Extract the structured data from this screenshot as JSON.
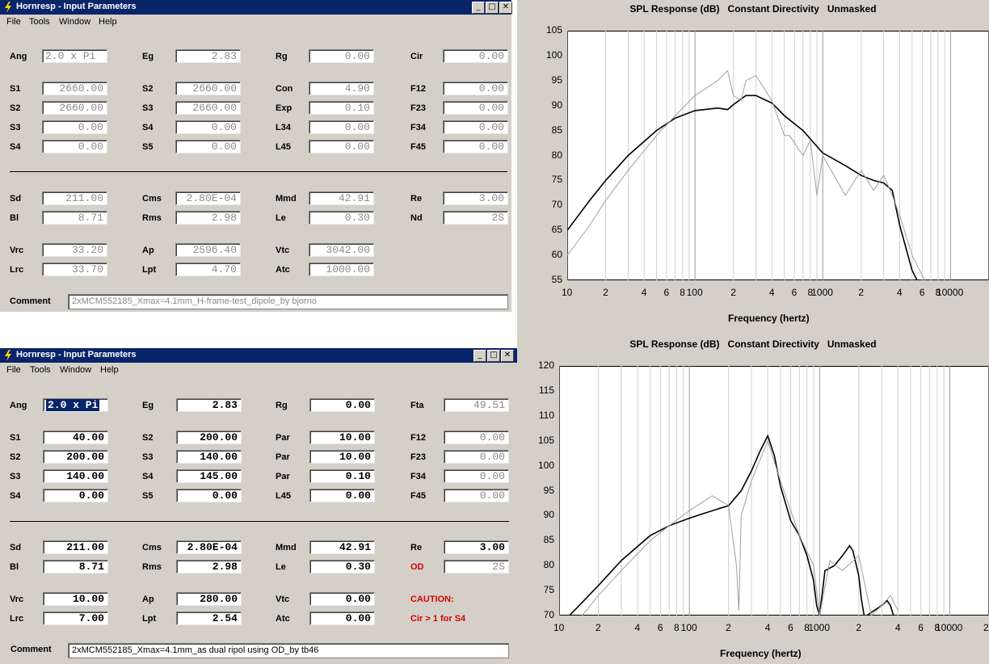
{
  "window1": {
    "title": "Hornresp - Input Parameters",
    "menu": [
      "File",
      "Tools",
      "Window",
      "Help"
    ],
    "rows": [
      [
        "Ang",
        "2.0 x Pi",
        "Eg",
        "2.83",
        "Rg",
        "0.00",
        "Cir",
        "0.00"
      ],
      [
        "S1",
        "2660.00",
        "S2",
        "2660.00",
        "Con",
        "4.90",
        "F12",
        "0.00"
      ],
      [
        "S2",
        "2660.00",
        "S3",
        "2660.00",
        "Exp",
        "0.10",
        "F23",
        "0.00"
      ],
      [
        "S3",
        "0.00",
        "S4",
        "0.00",
        "L34",
        "0.00",
        "F34",
        "0.00"
      ],
      [
        "S4",
        "0.00",
        "S5",
        "0.00",
        "L45",
        "0.00",
        "F45",
        "0.00"
      ],
      [
        "Sd",
        "211.00",
        "Cms",
        "2.80E-04",
        "Mmd",
        "42.91",
        "Re",
        "3.00"
      ],
      [
        "Bl",
        "8.71",
        "Rms",
        "2.98",
        "Le",
        "0.30",
        "Nd",
        "2S"
      ],
      [
        "Vrc",
        "33.20",
        "Ap",
        "2596.40",
        "Vtc",
        "3042.00",
        "",
        ""
      ],
      [
        "Lrc",
        "33.70",
        "Lpt",
        "4.70",
        "Atc",
        "1000.00",
        "",
        ""
      ]
    ],
    "comment_label": "Comment",
    "comment": "2xMCM552185_Xmax=4.1mm_H-frame-test_dipole_by bjorno"
  },
  "window2": {
    "title": "Hornresp - Input Parameters",
    "menu": [
      "File",
      "Tools",
      "Window",
      "Help"
    ],
    "rows": [
      [
        "Ang",
        "2.0 x Pi",
        "Eg",
        "2.83",
        "Rg",
        "0.00",
        "Fta",
        "49.51"
      ],
      [
        "S1",
        "40.00",
        "S2",
        "200.00",
        "Par",
        "10.00",
        "F12",
        "0.00"
      ],
      [
        "S2",
        "200.00",
        "S3",
        "140.00",
        "Par",
        "10.00",
        "F23",
        "0.00"
      ],
      [
        "S3",
        "140.00",
        "S4",
        "145.00",
        "Par",
        "0.10",
        "F34",
        "0.00"
      ],
      [
        "S4",
        "0.00",
        "S5",
        "0.00",
        "L45",
        "0.00",
        "F45",
        "0.00"
      ],
      [
        "Sd",
        "211.00",
        "Cms",
        "2.80E-04",
        "Mmd",
        "42.91",
        "Re",
        "3.00"
      ],
      [
        "Bl",
        "8.71",
        "Rms",
        "2.98",
        "Le",
        "0.30",
        "OD",
        "2S"
      ],
      [
        "Vrc",
        "10.00",
        "Ap",
        "280.00",
        "Vtc",
        "0.00",
        "CAUTION:",
        ""
      ],
      [
        "Lrc",
        "7.00",
        "Lpt",
        "2.54",
        "Atc",
        "0.00",
        "Cir > 1 for S4",
        ""
      ]
    ],
    "comment_label": "Comment",
    "comment": "2xMCM552185_Xmax=4.1mm_as dual ripol using OD_by tb46"
  },
  "chart_data": [
    {
      "type": "line",
      "title": "SPL Response (dB)   Constant Directivity   Unmasked",
      "xlabel": "Frequency (hertz)",
      "ylabel": "",
      "xscale": "log",
      "xlim": [
        10,
        20000
      ],
      "ylim": [
        55,
        105
      ],
      "yticks": [
        55,
        60,
        65,
        70,
        75,
        80,
        85,
        90,
        95,
        100,
        105
      ],
      "xticklabels": [
        "10",
        "2",
        "4",
        "6",
        "8",
        "100",
        "2",
        "4",
        "6",
        "8",
        "1000",
        "2",
        "4",
        "6",
        "8",
        "10000"
      ],
      "series": [
        {
          "color": "#000000",
          "x": [
            10,
            15,
            20,
            30,
            50,
            70,
            100,
            150,
            180,
            200,
            250,
            300,
            400,
            500,
            700,
            1000,
            1500,
            2000,
            2500,
            3000,
            3500,
            4000,
            5000,
            6000,
            7000,
            8000
          ],
          "y": [
            65,
            71,
            75,
            80,
            85,
            87.5,
            89,
            89.5,
            89.2,
            90.2,
            92,
            92,
            90.5,
            88,
            85,
            80.5,
            78,
            76,
            75,
            74.5,
            73,
            66,
            57,
            53,
            51,
            49
          ]
        },
        {
          "color": "#a0a0a0",
          "x": [
            10,
            15,
            20,
            30,
            50,
            70,
            100,
            150,
            180,
            200,
            230,
            250,
            300,
            400,
            500,
            550,
            700,
            800,
            900,
            1000,
            1500,
            2000,
            2500,
            3000,
            3500,
            4000,
            5000,
            6000,
            7000,
            8000
          ],
          "y": [
            60,
            66,
            71,
            77,
            84,
            88,
            92,
            95,
            97,
            92,
            91,
            95,
            96,
            91,
            84,
            84,
            80,
            83,
            72,
            80,
            72,
            77,
            73,
            76,
            72,
            68,
            60,
            56,
            53,
            52
          ]
        }
      ]
    },
    {
      "type": "line",
      "title": "SPL Response (dB)   Constant Directivity   Unmasked",
      "xlabel": "Frequency (hertz)",
      "ylabel": "",
      "xscale": "log",
      "xlim": [
        10,
        20000
      ],
      "ylim": [
        70,
        120
      ],
      "yticks": [
        70,
        75,
        80,
        85,
        90,
        95,
        100,
        105,
        110,
        115,
        120
      ],
      "xticklabels": [
        "10",
        "2",
        "4",
        "6",
        "8",
        "100",
        "2",
        "4",
        "6",
        "8",
        "1000",
        "2",
        "4",
        "6",
        "8",
        "10000",
        "2"
      ],
      "series": [
        {
          "color": "#000000",
          "x": [
            12,
            20,
            30,
            50,
            70,
            100,
            150,
            200,
            250,
            300,
            350,
            400,
            450,
            500,
            600,
            700,
            800,
            900,
            950,
            1000,
            1100,
            1300,
            1500,
            1700,
            1800,
            2000,
            2100,
            2200,
            2300,
            3000,
            3300,
            3500,
            3700,
            3900
          ],
          "y": [
            70,
            76,
            81,
            86,
            88,
            89.5,
            91,
            92,
            95,
            99,
            103,
            106,
            102,
            96,
            89,
            86,
            82,
            77,
            72,
            70,
            79,
            80,
            82,
            84,
            83,
            78,
            73,
            70,
            70,
            72,
            73,
            72,
            70,
            70
          ]
        },
        {
          "color": "#a0a0a0",
          "x": [
            15,
            20,
            30,
            50,
            70,
            100,
            150,
            200,
            230,
            240,
            250,
            300,
            400,
            500,
            700,
            900,
            1000,
            1200,
            1500,
            2000,
            2500,
            3000,
            3500,
            4000
          ],
          "y": [
            70,
            74,
            79,
            85,
            88,
            91,
            94,
            92,
            80,
            71,
            90,
            97,
            105,
            97,
            86,
            80,
            70,
            81,
            79,
            82,
            70,
            72,
            74,
            71
          ]
        }
      ]
    }
  ]
}
